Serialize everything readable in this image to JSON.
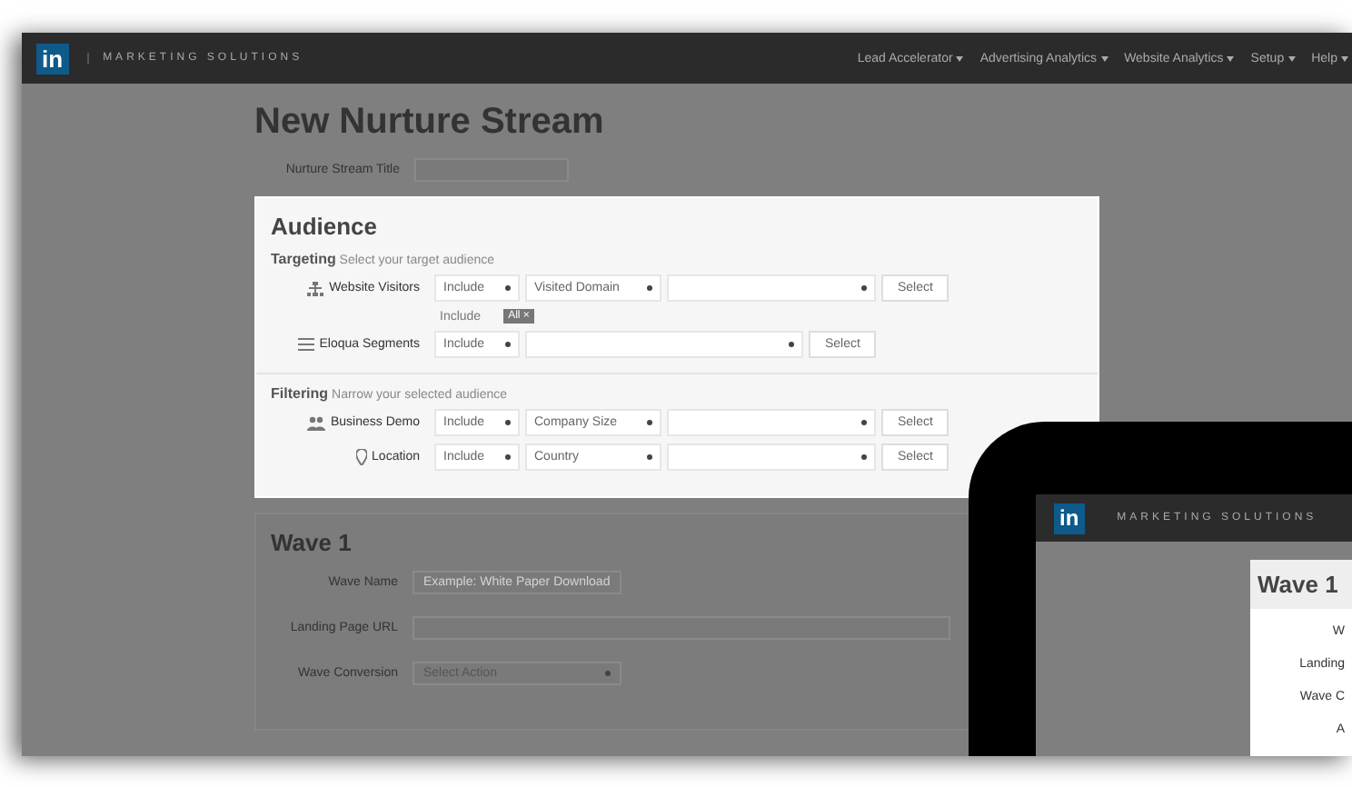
{
  "navbar": {
    "logo": "in",
    "brand": "MARKETING SOLUTIONS",
    "menus": [
      "Lead Accelerator",
      "Advertising Analytics",
      "Website Analytics",
      "Setup",
      "Help"
    ]
  },
  "page_title": "New Nurture Stream",
  "title_field": {
    "label": "Nurture Stream Title"
  },
  "audience": {
    "heading": "Audience",
    "sections": [
      {
        "title": "Targeting",
        "hint": "Select your target audience",
        "rows": [
          {
            "kind": "sitemap",
            "label": "Website Visitors",
            "selects": [
              "Include",
              "Visited Domain"
            ],
            "button": "Select",
            "sub": {
              "label": "Include",
              "tag": "All",
              "remove": "×"
            }
          },
          {
            "kind": "list",
            "label": "Eloqua Segments",
            "selects": [
              "Include"
            ],
            "button": "Select"
          }
        ]
      },
      {
        "title": "Filtering",
        "hint": "Narrow your selected audience",
        "rows": [
          {
            "kind": "people",
            "label": "Business Demo",
            "selects": [
              "Include",
              "Company Size"
            ],
            "button": "Select"
          },
          {
            "kind": "pin",
            "label": "Location",
            "selects": [
              "Include",
              "Country"
            ],
            "button": "Select"
          }
        ]
      }
    ]
  },
  "wave": {
    "heading": "Wave 1",
    "fields": [
      {
        "kind": "text",
        "label": "Wave Name",
        "placeholder": "Example: White Paper Download"
      },
      {
        "kind": "url",
        "label": "Landing Page URL"
      },
      {
        "kind": "select",
        "label": "Wave Conversion",
        "value": "Select Action"
      }
    ]
  },
  "tablet": {
    "logo": "in",
    "brand": "MARKETING SOLUTIONS",
    "heading": "Wave 1",
    "labels": [
      "W",
      "Landing",
      "Wave C",
      "A"
    ]
  }
}
